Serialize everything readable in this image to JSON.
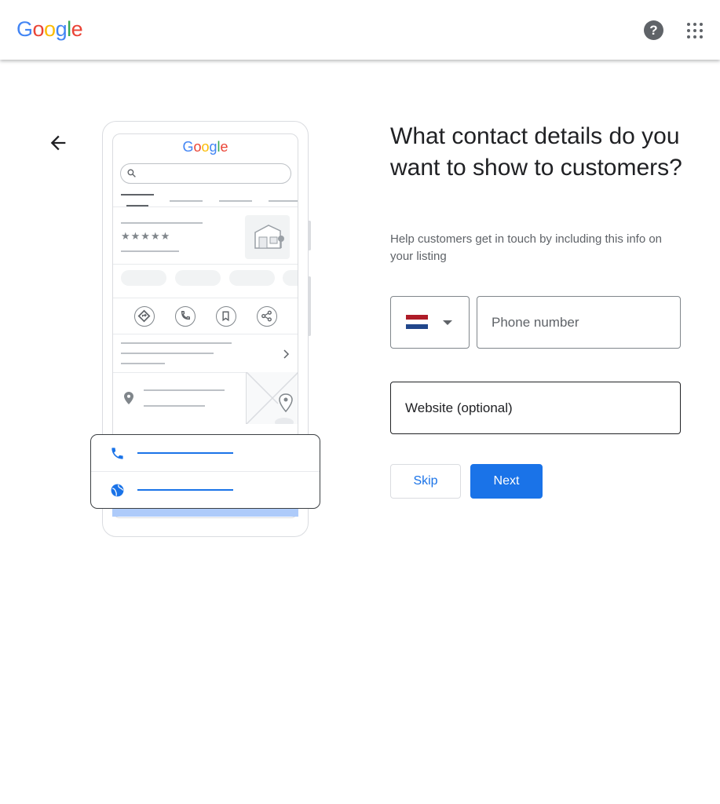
{
  "header": {
    "logo": "Google",
    "logo_colors": [
      "#4285F4",
      "#EA4335",
      "#FBBC05",
      "#4285F4",
      "#34A853",
      "#EA4335"
    ],
    "help_icon": "help-circle-icon",
    "apps_icon": "apps-grid-icon"
  },
  "nav": {
    "back_icon": "arrow-back-icon"
  },
  "illustration": {
    "logo": "Google",
    "stars": "★★★★★",
    "contact_icons": [
      "phone-icon",
      "globe-icon"
    ]
  },
  "form": {
    "title": "What contact details do you want to show to customers?",
    "subtitle": "Help customers get in touch by including this info on your listing",
    "country_flag": "netherlands-flag",
    "flag_colors": [
      "#AE1C28",
      "#FFFFFF",
      "#21468B"
    ],
    "phone_placeholder": "Phone number",
    "website_placeholder": "Website (optional)",
    "skip_label": "Skip",
    "next_label": "Next"
  },
  "colors": {
    "accent": "#1a73e8",
    "text": "#202124",
    "muted": "#5f6368"
  }
}
